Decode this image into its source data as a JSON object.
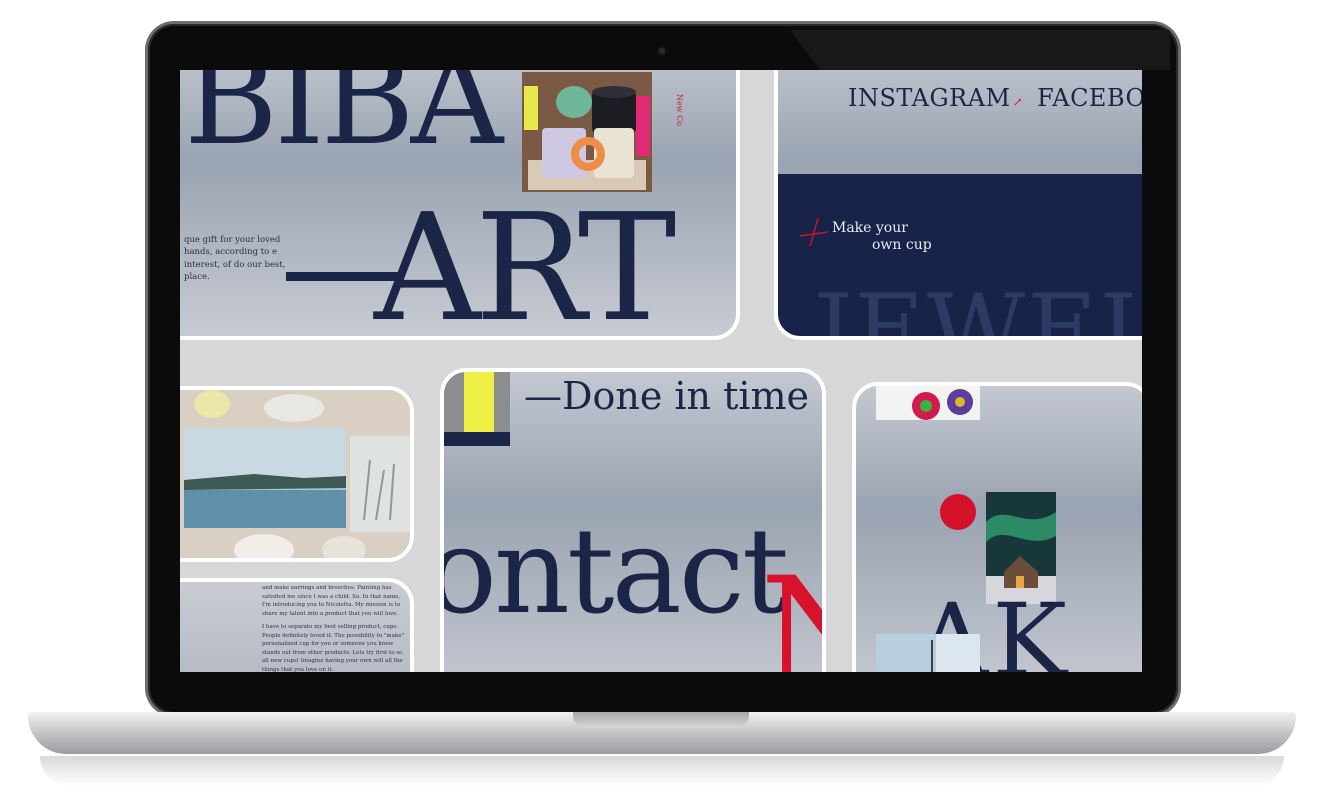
{
  "hero": {
    "title": "BIBA",
    "subtitle": "ART",
    "blurb": "que gift for your loved hands, according to e interest, of do our best, place.",
    "vertical_note": "New Co"
  },
  "social": {
    "links": [
      "INSTAGRAM",
      "FACEBOOK"
    ],
    "arrow": "↗"
  },
  "promo": {
    "line1": "Make your",
    "line2": "own cup",
    "ghost": "JEWEL"
  },
  "about": {
    "paragraph1": "and make earrings and brooches. Painting has satisfied me since I was a child. So. In that name, I'm introducing you to Nicoletta. My mission is to share my talent into a product that you will love.",
    "paragraph2": "I have to separate my best selling product, cups. People definitely loved it. The possibility to \"make\" personalized cup for you or someone you know stands out from other products. Lets try first to so all new cups! Imagine having your own will all the things that you love on it."
  },
  "contact": {
    "tagline": "—Done in time",
    "word": "ontact",
    "accent_letter": "N"
  },
  "art": {
    "letters": "AK"
  },
  "colors": {
    "navy": "#1b2547",
    "accent_red": "#d5102a",
    "promo_bg": "#172348"
  }
}
